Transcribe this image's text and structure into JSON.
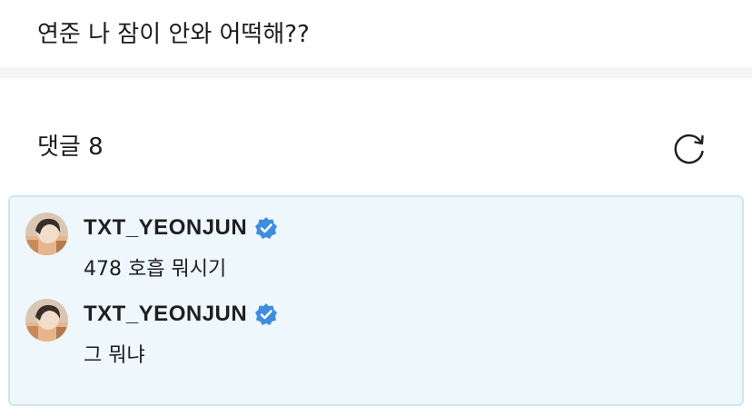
{
  "post": {
    "text": "연준 나 잠이 안와 어떡해??"
  },
  "comments_section": {
    "header_label": "댓글",
    "count": "8"
  },
  "comments": [
    {
      "author": "TXT_YEONJUN",
      "verified": true,
      "text": "478 호흡 뭐시기"
    },
    {
      "author": "TXT_YEONJUN",
      "verified": true,
      "text": "그 뭐냐"
    }
  ],
  "colors": {
    "verified_blue": "#3d8de0",
    "comment_bg": "#eef7fc",
    "comment_border": "#cfe6f3"
  },
  "icons": {
    "refresh": "refresh-icon",
    "verified": "verified-badge-icon"
  }
}
